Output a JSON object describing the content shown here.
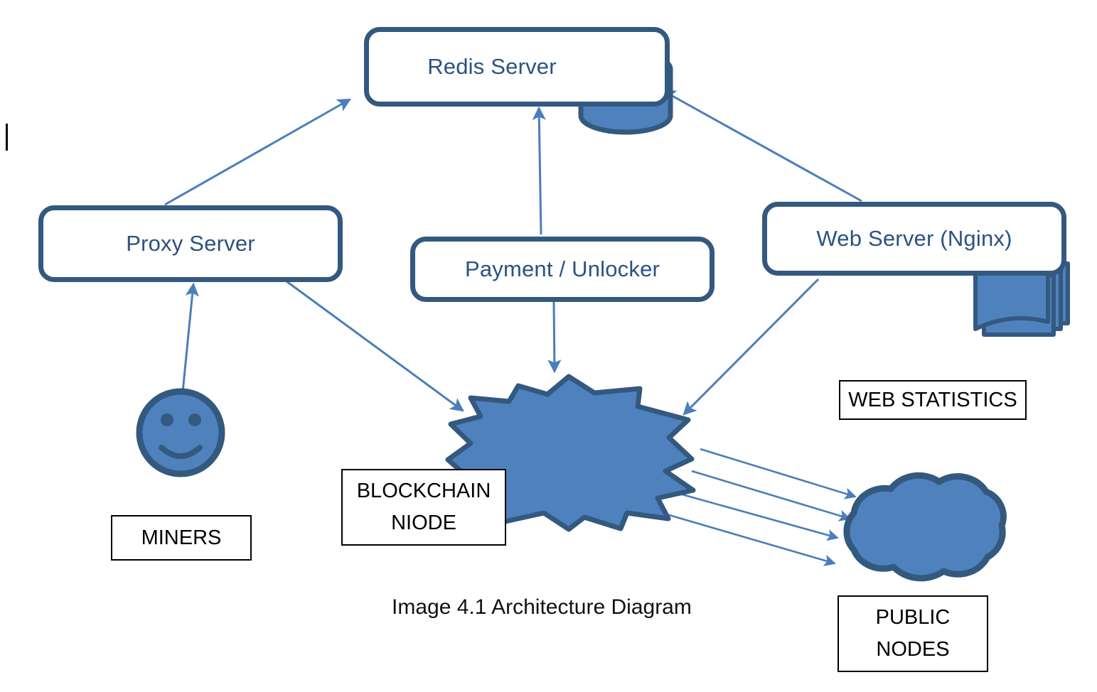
{
  "diagram": {
    "caption": "Image 4.1 Architecture Diagram",
    "background_color": "#FFFFFF",
    "accent_fill": "#4F81BD",
    "accent_stroke": "#33597F",
    "box_text_color": "#2B5280",
    "label_text_color": "#000000",
    "arrow_color": "#4A7EBB"
  },
  "nodes": {
    "redis_server": {
      "label": "Redis Server",
      "icon": "database-cylinder-icon",
      "type": "rounded-rect"
    },
    "proxy_server": {
      "label": "Proxy Server",
      "type": "rounded-rect"
    },
    "payment_unlocker": {
      "label": "Payment / Unlocker",
      "type": "rounded-rect"
    },
    "web_server": {
      "label": "Web Server (Nginx)",
      "icon": "stacked-documents-icon",
      "type": "rounded-rect"
    },
    "blockchain_node": {
      "icon": "starburst-icon",
      "type": "explosion"
    },
    "miner": {
      "icon": "smiley-face-icon",
      "type": "circle"
    },
    "public_nodes_cloud": {
      "icon": "cloud-icon",
      "type": "cloud"
    }
  },
  "labels": {
    "miners": {
      "lines": [
        "MINERS"
      ]
    },
    "blockchain_node": {
      "lines": [
        "BLOCKCHAIN",
        "NIODE"
      ]
    },
    "web_statistics": {
      "lines": [
        "WEB STATISTICS"
      ]
    },
    "public_nodes": {
      "lines": [
        "PUBLIC",
        "NODES"
      ]
    }
  },
  "labels_flat": {
    "miners_line1": "MINERS",
    "blockchain_line1": "BLOCKCHAIN",
    "blockchain_line2": "NIODE",
    "web_statistics_line1": "WEB STATISTICS",
    "public_nodes_line1": "PUBLIC",
    "public_nodes_line2": "NODES"
  },
  "connections": [
    {
      "name": "proxy-to-redis",
      "from": "proxy_server",
      "to": "redis_server",
      "direction": "one-way"
    },
    {
      "name": "payment-to-redis",
      "from": "payment_unlocker",
      "to": "redis_server",
      "direction": "one-way"
    },
    {
      "name": "webserver-to-redis",
      "from": "web_server",
      "to": "redis_server",
      "direction": "one-way"
    },
    {
      "name": "miner-to-proxy",
      "from": "miner",
      "to": "proxy_server",
      "direction": "one-way"
    },
    {
      "name": "proxy-to-blockchain",
      "from": "proxy_server",
      "to": "blockchain_node",
      "direction": "one-way"
    },
    {
      "name": "payment-to-blockchain",
      "from": "payment_unlocker",
      "to": "blockchain_node",
      "direction": "one-way"
    },
    {
      "name": "webserver-to-blockchain",
      "from": "web_server",
      "to": "blockchain_node",
      "direction": "one-way"
    },
    {
      "name": "blockchain-to-public-nodes-1",
      "from": "blockchain_node",
      "to": "public_nodes_cloud",
      "direction": "one-way"
    },
    {
      "name": "blockchain-to-public-nodes-2",
      "from": "blockchain_node",
      "to": "public_nodes_cloud",
      "direction": "one-way"
    },
    {
      "name": "blockchain-to-public-nodes-3",
      "from": "blockchain_node",
      "to": "public_nodes_cloud",
      "direction": "one-way"
    },
    {
      "name": "blockchain-to-public-nodes-4",
      "from": "blockchain_node",
      "to": "public_nodes_cloud",
      "direction": "one-way"
    }
  ]
}
